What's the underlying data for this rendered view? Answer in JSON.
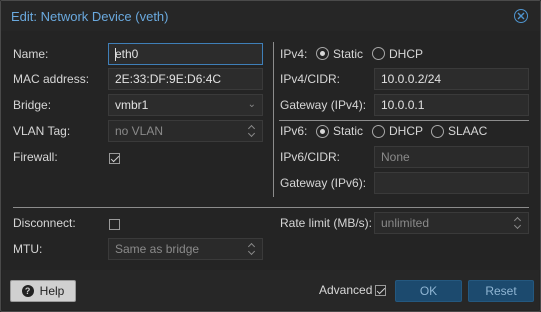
{
  "dialog": {
    "title": "Edit: Network Device (veth)"
  },
  "left": {
    "name_label": "Name:",
    "name_value": "eth0",
    "mac_label": "MAC address:",
    "mac_value": "2E:33:DF:9E:D6:4C",
    "bridge_label": "Bridge:",
    "bridge_value": "vmbr1",
    "vlan_label": "VLAN Tag:",
    "vlan_placeholder": "no VLAN",
    "firewall_label": "Firewall:",
    "firewall_checked": true
  },
  "right": {
    "ipv4_label": "IPv4:",
    "ipv4_static": "Static",
    "ipv4_dhcp": "DHCP",
    "ipv4_cidr_label": "IPv4/CIDR:",
    "ipv4_cidr_value": "10.0.0.2/24",
    "gw4_label": "Gateway (IPv4):",
    "gw4_value": "10.0.0.1",
    "ipv6_label": "IPv6:",
    "ipv6_static": "Static",
    "ipv6_dhcp": "DHCP",
    "ipv6_slaac": "SLAAC",
    "ipv6_cidr_label": "IPv6/CIDR:",
    "ipv6_cidr_placeholder": "None",
    "gw6_label": "Gateway (IPv6):",
    "gw6_value": ""
  },
  "advanced": {
    "disconnect_label": "Disconnect:",
    "disconnect_checked": false,
    "mtu_label": "MTU:",
    "mtu_placeholder": "Same as bridge",
    "rate_label": "Rate limit (MB/s):",
    "rate_placeholder": "unlimited"
  },
  "footer": {
    "help_label": "Help",
    "advanced_label": "Advanced",
    "advanced_checked": true,
    "ok_label": "OK",
    "reset_label": "Reset"
  },
  "colors": {
    "accent": "#6aa9de",
    "button_primary": "#1c4a6e"
  }
}
